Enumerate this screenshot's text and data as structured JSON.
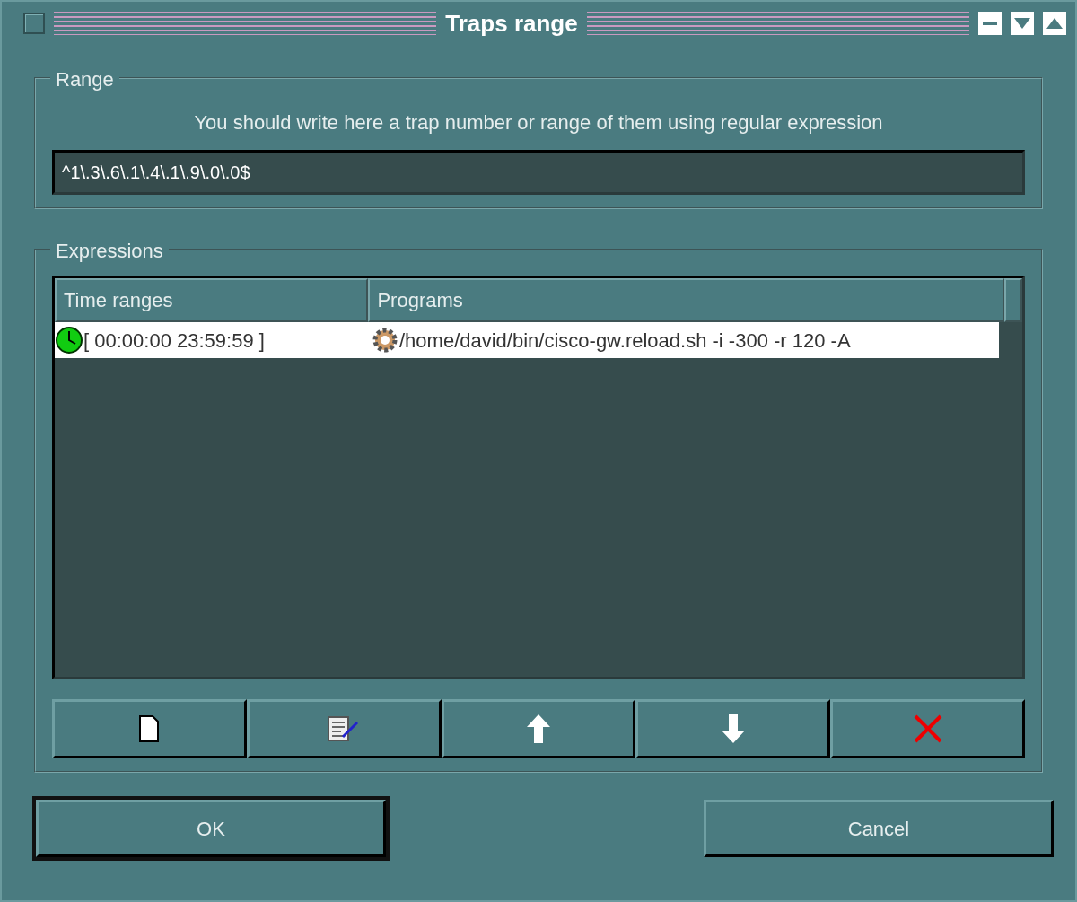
{
  "window": {
    "title": "Traps range"
  },
  "range": {
    "legend": "Range",
    "hint": "You should write here a trap number or range of them using regular expression",
    "value": "^1\\.3\\.6\\.1\\.4\\.1\\.9\\.0\\.0$"
  },
  "expressions": {
    "legend": "Expressions",
    "columns": [
      "Time ranges",
      "Programs"
    ],
    "rows": [
      {
        "time": "[ 00:00:00 23:59:59 ]",
        "program": "/home/david/bin/cisco-gw.reload.sh -i -300 -r 120 -A"
      }
    ],
    "tools": [
      {
        "kind": "new"
      },
      {
        "kind": "edit"
      },
      {
        "kind": "up"
      },
      {
        "kind": "down"
      },
      {
        "kind": "delete"
      }
    ]
  },
  "buttons": [
    {
      "label": "OK",
      "default": true
    },
    {
      "label": "Cancel",
      "default": false
    }
  ]
}
